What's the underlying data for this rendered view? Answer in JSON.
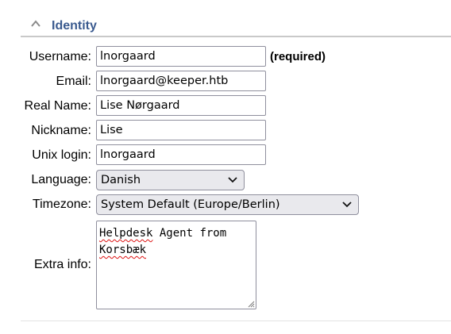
{
  "section": {
    "title": "Identity",
    "collapse_icon": "chevron-up-icon"
  },
  "fields": {
    "username": {
      "label": "Username:",
      "value": "lnorgaard",
      "note": "(required)"
    },
    "email": {
      "label": "Email:",
      "value": "lnorgaard@keeper.htb"
    },
    "realname": {
      "label": "Real Name:",
      "value": "Lise Nørgaard"
    },
    "nickname": {
      "label": "Nickname:",
      "value": "Lise"
    },
    "unixlogin": {
      "label": "Unix login:",
      "value": "lnorgaard"
    },
    "language": {
      "label": "Language:",
      "selected": "Danish"
    },
    "timezone": {
      "label": "Timezone:",
      "selected": "System Default (Europe/Berlin)"
    },
    "extrainfo": {
      "label": "Extra info:",
      "line1_word1": "Helpdesk",
      "line1_rest": " Agent from",
      "line2": "Korsbæk"
    }
  },
  "colors": {
    "section_title": "#3a5a8f",
    "spellcheck": "#dd1111"
  }
}
